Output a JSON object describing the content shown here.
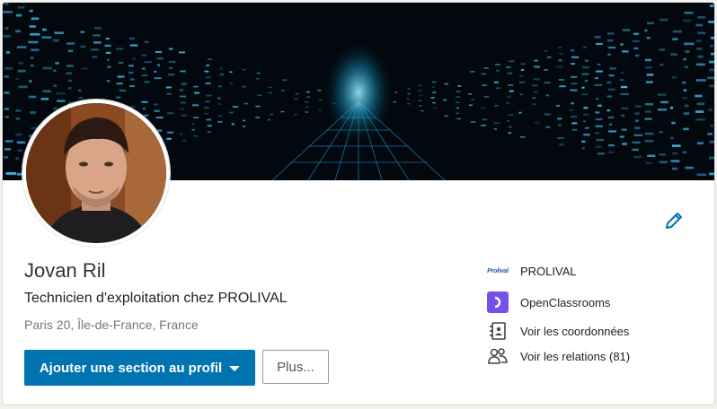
{
  "profile": {
    "name": "Jovan Ril",
    "headline": "Technicien d'exploitation chez PROLIVAL",
    "location": "Paris 20, Île-de-France, France"
  },
  "actions": {
    "add_section_label": "Ajouter une section au profil",
    "more_label": "Plus..."
  },
  "sidebar": {
    "items": [
      {
        "label": "PROLIVAL",
        "icon": "prolival-logo",
        "logo_text": "Prolival"
      },
      {
        "label": "OpenClassrooms",
        "icon": "openclassrooms-logo"
      },
      {
        "label": "Voir les coordonnées",
        "icon": "contact-card-icon"
      },
      {
        "label": "Voir les relations (81)",
        "icon": "people-icon"
      }
    ]
  },
  "colors": {
    "primary": "#0073b1",
    "openclassrooms": "#7451eb",
    "banner_glow": "#29b6e8"
  }
}
